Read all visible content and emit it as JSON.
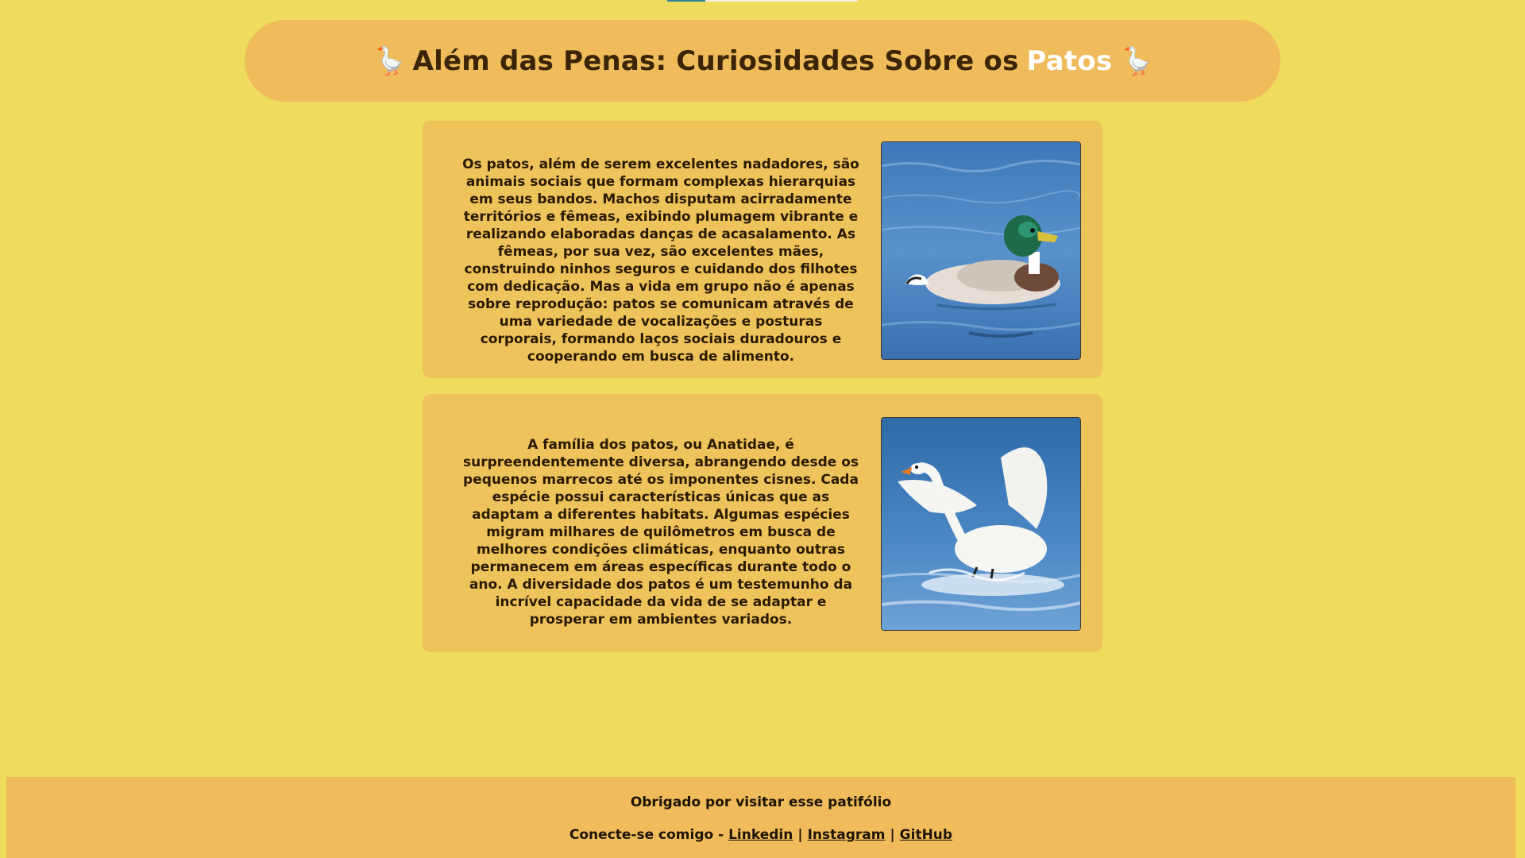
{
  "header": {
    "title_main": "Além das Penas: Curiosidades Sobre os",
    "title_accent": "Patos",
    "left_emoji": "🪿",
    "right_emoji": "🪿"
  },
  "cards": [
    {
      "text": "Os patos, além de serem excelentes nadadores, são animais sociais que formam complexas hierarquias em seus bandos. Machos disputam acirradamente territórios e fêmeas, exibindo plumagem vibrante e realizando elaboradas danças de acasalamento. As fêmeas, por sua vez, são excelentes mães, construindo ninhos seguros e cuidando dos filhotes com dedicação. Mas a vida em grupo não é apenas sobre reprodução: patos se comunicam através de uma variedade de vocalizações e posturas corporais, formando laços sociais duradouros e cooperando em busca de alimento."
    },
    {
      "text": "A família dos patos, ou Anatidae, é surpreendentemente diversa, abrangendo desde os pequenos marrecos até os imponentes cisnes. Cada espécie possui características únicas que as adaptam a diferentes habitats. Algumas espécies migram milhares de quilômetros em busca de melhores condições climáticas, enquanto outras permanecem em áreas específicas durante todo o ano. A diversidade dos patos é um testemunho da incrível capacidade da vida de se adaptar e prosperar em ambientes variados."
    }
  ],
  "footer": {
    "thanks": "Obrigado por visitar esse patifólio",
    "connect_prefix": "Conecte-se comigo -",
    "links": [
      "Linkedin",
      "Instagram",
      "GitHub"
    ],
    "separator": "|"
  },
  "colors": {
    "page_background": "#efdc5e",
    "header_background": "#efbb5b",
    "card_background": "#efc35b",
    "title_text": "#3b2506",
    "title_accent": "#ffffff"
  }
}
